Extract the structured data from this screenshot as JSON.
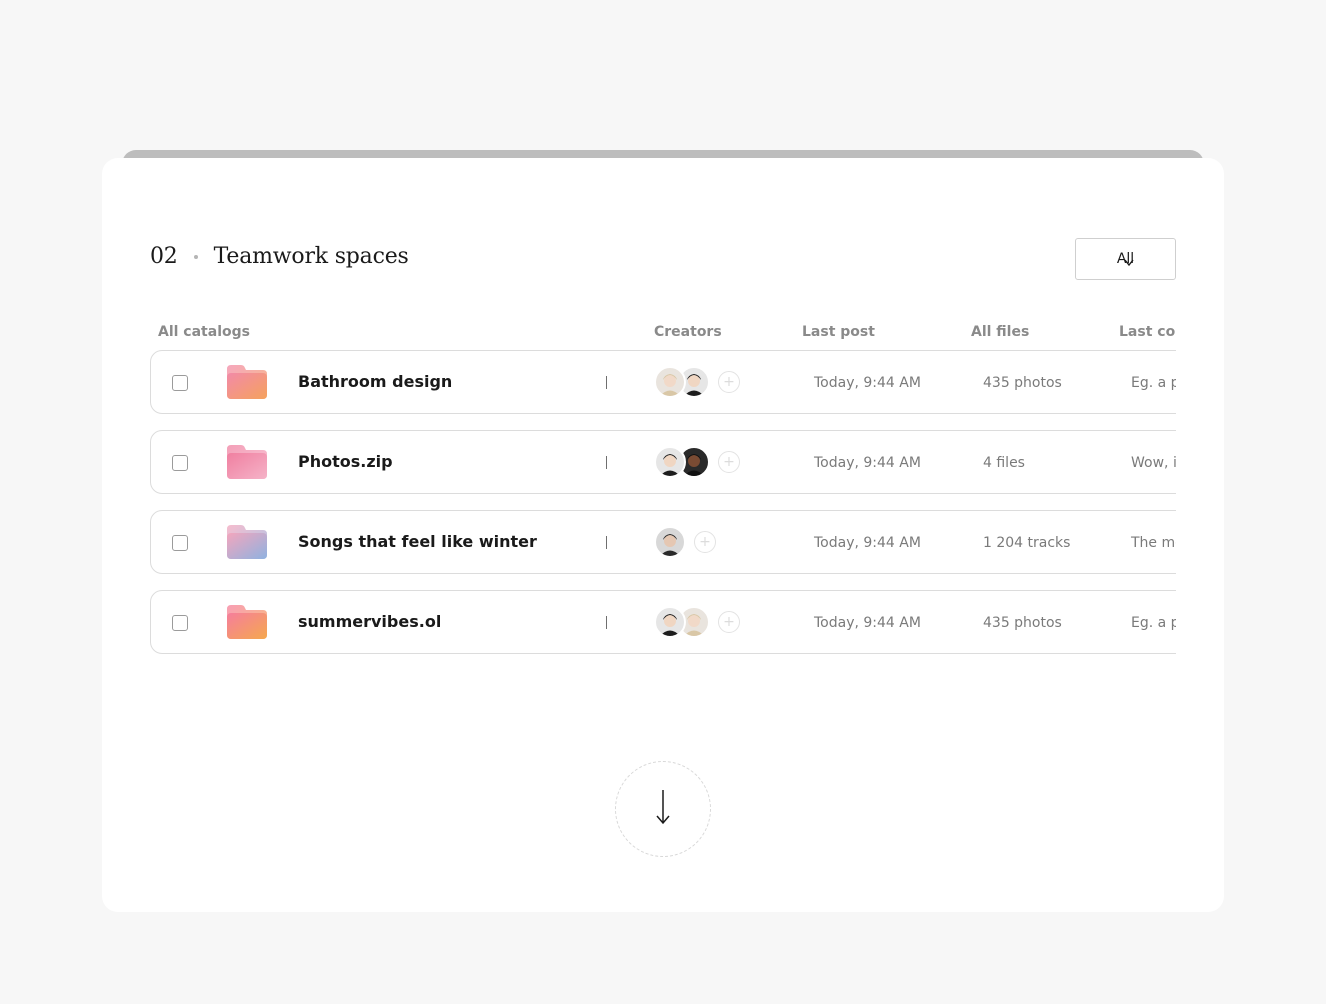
{
  "section": {
    "number": "02",
    "title": "Teamwork spaces"
  },
  "filter": {
    "label": "All",
    "icon": "chevron-down-icon"
  },
  "columns": [
    "All catalogs",
    "Creators",
    "Last post",
    "All files",
    "Last comment"
  ],
  "rows": [
    {
      "name": "Bathroom design",
      "folder_colors": [
        "#f28aa8",
        "#f5a25d"
      ],
      "creators": [
        "avatar-woman-blonde",
        "avatar-man-dark-hair"
      ],
      "last_post": "Today, 9:44 AM",
      "files": "435 photos",
      "last_comment": "Eg. a p"
    },
    {
      "name": "Photos.zip",
      "folder_colors": [
        "#f07fa0",
        "#f5b3c8"
      ],
      "creators": [
        "avatar-man-dark-hair",
        "avatar-woman-dark-skin"
      ],
      "last_post": "Today, 9:44 AM",
      "files": "4 files",
      "last_comment": "Wow, i"
    },
    {
      "name": "Songs that feel like winter",
      "folder_colors": [
        "#f3a6bd",
        "#8fb2e0"
      ],
      "creators": [
        "avatar-man-beard"
      ],
      "last_post": "Today, 9:44 AM",
      "files": "1 204 tracks",
      "last_comment": "The mo"
    },
    {
      "name": "summervibes.ol",
      "folder_colors": [
        "#f57e9c",
        "#f5a84e"
      ],
      "creators": [
        "avatar-man-dark-hair",
        "avatar-woman-blonde"
      ],
      "last_post": "Today, 9:44 AM",
      "files": "435 photos",
      "last_comment": "Eg. a p"
    }
  ],
  "scroll_button": {
    "icon": "arrow-down-icon"
  }
}
